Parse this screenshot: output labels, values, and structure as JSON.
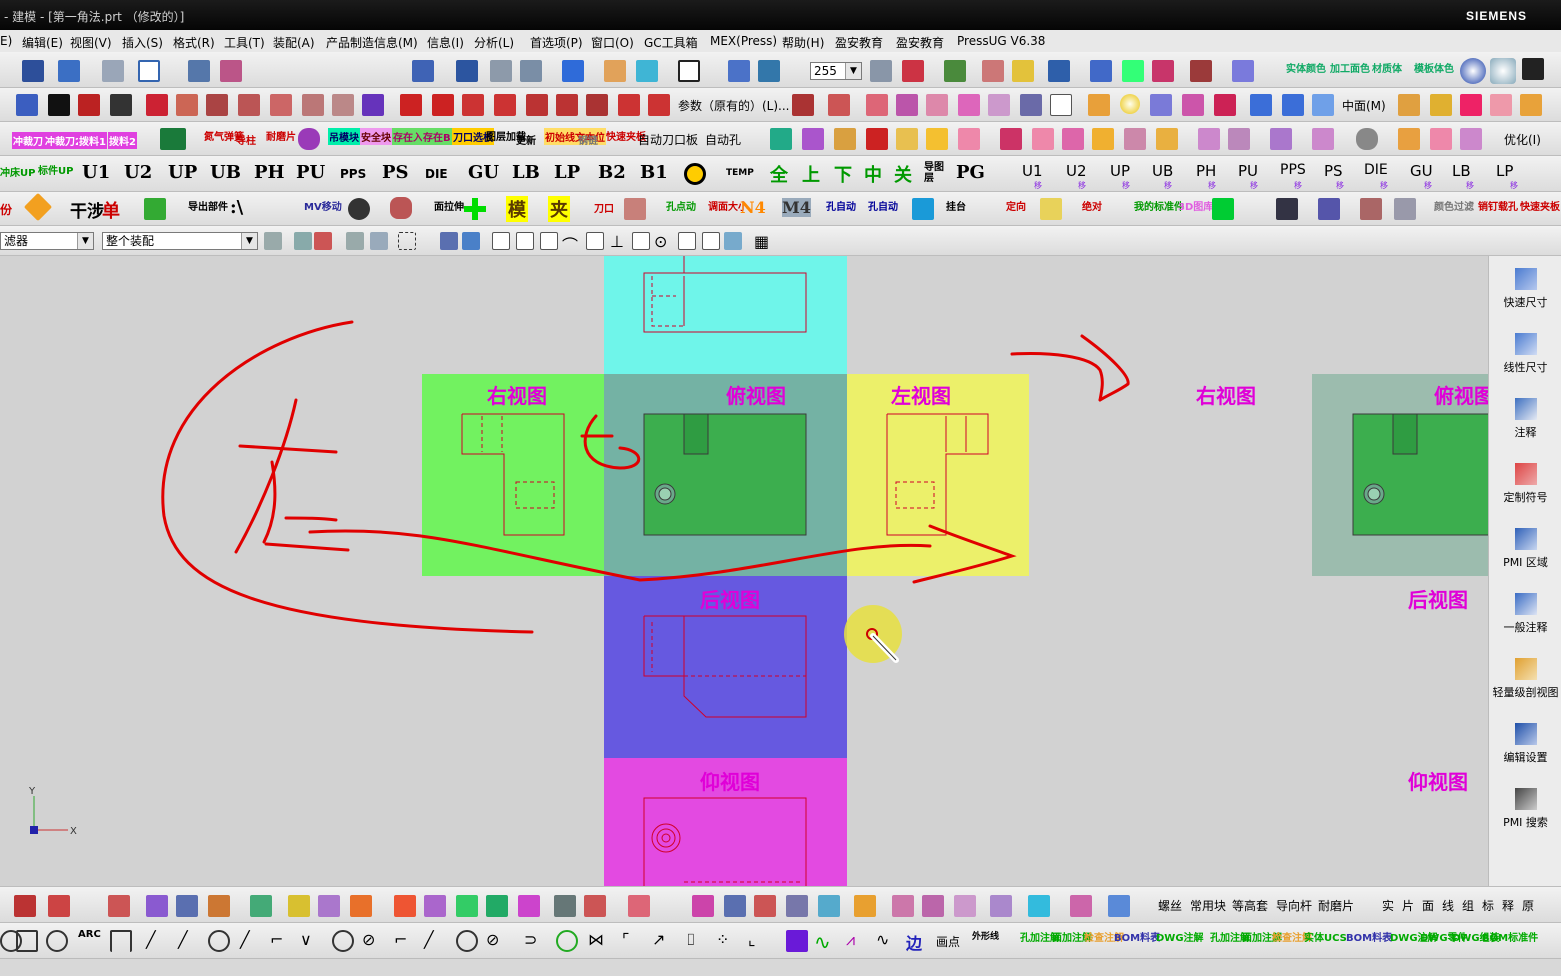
{
  "window": {
    "title": "- 建模 - [第一角法.prt （修改的）]",
    "brand": "SIEMENS"
  },
  "menu": [
    "E)",
    "编辑(E)",
    "视图(V)",
    "插入(S)",
    "格式(R)",
    "工具(T)",
    "装配(A)",
    "产品制造信息(M)",
    "信息(I)",
    "分析(L)",
    "首选项(P)",
    "窗口(O)",
    "GC工具箱",
    "MEX(Press)",
    "帮助(H)",
    "盈安教育",
    "盈安教育",
    "PressUG V6.38"
  ],
  "toolbar1": {
    "layer_value": "255",
    "labels": [
      "实体颜色",
      "加工面色",
      "材质体",
      "模板体色"
    ]
  },
  "toolbar2": {
    "params_label": "参数（原有的）(L)...",
    "midplane_label": "中面(M)"
  },
  "toolbar3": {
    "labels": [
      "冲裁刀1",
      "冲裁刀2",
      "拨料1",
      "拨料2",
      "氮气弹簧",
      "导柱",
      "耐磨片",
      "吊模块",
      "安全块",
      "存在入",
      "存在B",
      "刀口选板",
      "图层加载",
      "更新",
      "初始线文本位",
      "钢链",
      "快速夹板",
      "自动刀口板",
      "自动孔",
      "优化(I)"
    ]
  },
  "toolbar4": {
    "labels": [
      "冲床UP",
      "标件UP",
      "U1",
      "U2",
      "UP",
      "UB",
      "PH",
      "PU",
      "PPS",
      "PS",
      "DIE",
      "GU",
      "LB",
      "LP",
      "B2",
      "B1",
      "TEMP",
      "全",
      "上",
      "下",
      "中",
      "关",
      "导图层",
      "PG",
      "U1",
      "U2",
      "UP",
      "UB",
      "PH",
      "PU",
      "PPS",
      "PS",
      "DIE",
      "GU",
      "LB",
      "LP"
    ],
    "sub_label": "移"
  },
  "toolbar5": {
    "labels": [
      "份",
      "干涉",
      "单",
      "导出部件",
      ":\\",
      "MV移动",
      "面拉伸",
      "模",
      "夹",
      "刀口",
      "孔点动",
      "调面大小",
      "N4",
      "M4",
      "孔自动",
      "孔自动",
      "挂台",
      "定向",
      "绝对",
      "我的标准件",
      "3D图库",
      "颜色过滤",
      "销钉载孔",
      "快速夹板"
    ]
  },
  "filter": {
    "type_filter": "滤器",
    "scope_filter": "整个装配"
  },
  "views": {
    "right": "右视图",
    "top": "俯视图",
    "left": "左视图",
    "back": "后视图",
    "bottom": "仰视图",
    "right2": "右视图",
    "top2": "俯视图",
    "back2": "后视图",
    "bottom2": "仰视图"
  },
  "triad": {
    "x": "X",
    "y": "Y"
  },
  "resource_bar": [
    {
      "icon": "rapid-dimension-icon",
      "label": "快速尺寸"
    },
    {
      "icon": "linear-dimension-icon",
      "label": "线性尺寸"
    },
    {
      "icon": "note-icon",
      "label": "注释"
    },
    {
      "icon": "custom-symbol-icon",
      "label": "定制符号"
    },
    {
      "icon": "pmi-region-icon",
      "label": "PMI 区域"
    },
    {
      "icon": "general-note-icon",
      "label": "一般注释"
    },
    {
      "icon": "lightweight-section-icon",
      "label": "轻量级剖视图"
    },
    {
      "icon": "edit-settings-icon",
      "label": "编辑设置"
    },
    {
      "icon": "pmi-search-icon",
      "label": "PMI 搜索"
    }
  ],
  "bottombar1": {
    "labels": [
      "螺丝",
      "常用块",
      "等高套",
      "导向杆",
      "耐磨片",
      "实",
      "片",
      "面",
      "线",
      "组",
      "标",
      "释",
      "原"
    ]
  },
  "bottombar2": {
    "labels": [
      "ARC",
      "画点",
      "外形线",
      "孔加注解",
      "面加注解",
      "检查注解",
      "BOM料表",
      "DWG注解",
      "孔加注解",
      "面加注解",
      "检查注解",
      "实体UCS",
      "BOM料表",
      "DWG注解",
      "DWG零件",
      "DWG组装",
      "BOM标准件"
    ]
  },
  "colors": {
    "cyan_panel": "#6ff5ea",
    "green_panel": "#72f260",
    "gray_panel": "#74b2a4",
    "yellow_panel": "#ecf06a",
    "blue_panel": "#6659e0",
    "magenta_panel": "#e34ae1",
    "view_label": "#e000d8",
    "annotation_red": "#e00000"
  }
}
